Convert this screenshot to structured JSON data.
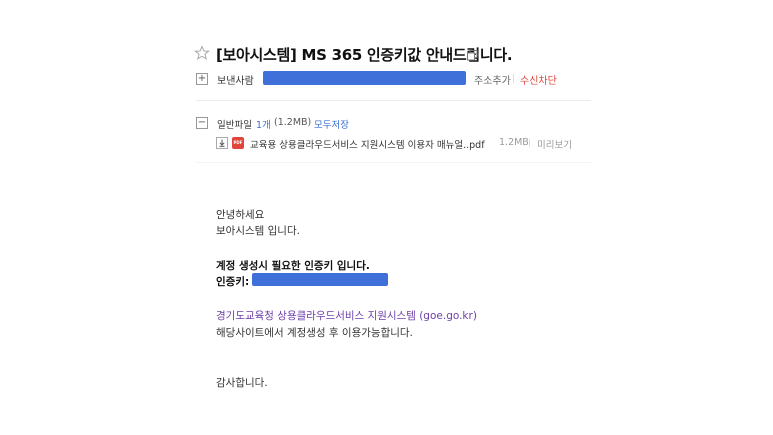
{
  "mail": {
    "subject": "[보아시스템] MS 365 인증키값 안내드립니다.",
    "sender_label": "보낸사람",
    "add_address": "주소추가",
    "block": "수신차단"
  },
  "attachments": {
    "toggle": "−",
    "title": "일반파일",
    "count": "1개",
    "total_size": "(1.2MB)",
    "save_all": "모두저장",
    "files": [
      {
        "type_badge": "PDF",
        "name": "교육용 상용클라우드서비스 지원시스템 이용자 매뉴얼..pdf",
        "size": "1.2MB",
        "preview": "미리보기"
      }
    ]
  },
  "body": {
    "greeting": "안녕하세요",
    "intro": "보아시스템 입니다.",
    "notice": "계정 생성시 필요한 인증키 입니다.",
    "key_label": "인증키:",
    "link_text": "경기도교육청 상용클라우드서비스 지원시스템 (goe.go.kr)",
    "instruction": "해당사이트에서 계정생성 후 이용가능합니다.",
    "closing": "감사합니다."
  },
  "colors": {
    "redaction": "#3f6fd8",
    "link_blue": "#3b6fd1",
    "block_red": "#e0453c",
    "link_purple": "#6c3fa8"
  }
}
